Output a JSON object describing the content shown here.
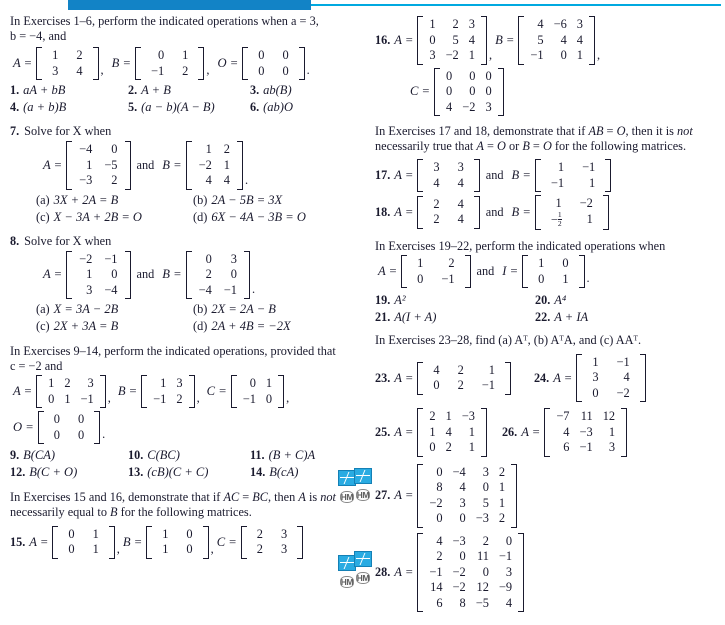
{
  "header": {
    "accent_color": "#1283c6",
    "rule_color": "#00a9e0"
  },
  "icons": {
    "graph_icon_name": "graphing-utility-icon",
    "hm_icon_label": "HM"
  },
  "left_column": {
    "intro_1_6": {
      "line1": "In Exercises 1–6, perform the indicated operations when a = 3,",
      "line2": "b = −4, and"
    },
    "defs_1_6": {
      "A_label": "A =",
      "A": [
        [
          "1",
          "2"
        ],
        [
          "3",
          "4"
        ]
      ],
      "A_punct": ",",
      "B_label": "B =",
      "B": [
        [
          "0",
          "1"
        ],
        [
          "−1",
          "2"
        ]
      ],
      "B_punct": ",",
      "O_label": "O =",
      "O": [
        [
          "0",
          "0"
        ],
        [
          "0",
          "0"
        ]
      ],
      "O_punct": "."
    },
    "ex_1_6": [
      {
        "num": "1.",
        "expr": "aA + bB"
      },
      {
        "num": "2.",
        "expr": "A + B"
      },
      {
        "num": "3.",
        "expr": "ab(B)"
      },
      {
        "num": "4.",
        "expr": "(a + b)B"
      },
      {
        "num": "5.",
        "expr": "(a − b)(A − B)"
      },
      {
        "num": "6.",
        "expr": "(ab)O"
      }
    ],
    "ex7": {
      "num": "7.",
      "prompt": "Solve for X when",
      "A_label": "A =",
      "A": [
        [
          "−4",
          "0"
        ],
        [
          "1",
          "−5"
        ],
        [
          "−3",
          "2"
        ]
      ],
      "and": "and",
      "B_label": "B =",
      "B": [
        [
          "1",
          "2"
        ],
        [
          "−2",
          "1"
        ],
        [
          "4",
          "4"
        ]
      ],
      "B_punct": ".",
      "options": [
        {
          "label": "(a)",
          "expr": "3X + 2A = B"
        },
        {
          "label": "(b)",
          "expr": "2A − 5B = 3X"
        },
        {
          "label": "(c)",
          "expr": "X − 3A + 2B = O"
        },
        {
          "label": "(d)",
          "expr": "6X − 4A − 3B = O"
        }
      ]
    },
    "ex8": {
      "num": "8.",
      "prompt": "Solve for X when",
      "A_label": "A =",
      "A": [
        [
          "−2",
          "−1"
        ],
        [
          "1",
          "0"
        ],
        [
          "3",
          "−4"
        ]
      ],
      "and": "and",
      "B_label": "B =",
      "B": [
        [
          "0",
          "3"
        ],
        [
          "2",
          "0"
        ],
        [
          "−4",
          "−1"
        ]
      ],
      "B_punct": ".",
      "options": [
        {
          "label": "(a)",
          "expr": "X = 3A − 2B"
        },
        {
          "label": "(b)",
          "expr": "2X = 2A − B"
        },
        {
          "label": "(c)",
          "expr": "2X + 3A = B"
        },
        {
          "label": "(d)",
          "expr": "2A + 4B = −2X"
        }
      ]
    },
    "intro_9_14": {
      "line1": "In Exercises 9–14, perform the indicated operations, provided that",
      "line2": "c = −2 and"
    },
    "defs_9_14": {
      "A_label": "A =",
      "A": [
        [
          "1",
          "2",
          "3"
        ],
        [
          "0",
          "1",
          "−1"
        ]
      ],
      "A_punct": ",",
      "B_label": "B =",
      "B": [
        [
          "1",
          "3"
        ],
        [
          "−1",
          "2"
        ]
      ],
      "B_punct": ",",
      "C_label": "C =",
      "C": [
        [
          "0",
          "1"
        ],
        [
          "−1",
          "0"
        ]
      ],
      "C_punct": ",",
      "O_label": "O =",
      "O": [
        [
          "0",
          "0"
        ],
        [
          "0",
          "0"
        ]
      ],
      "O_punct": "."
    },
    "ex_9_14": [
      {
        "num": "9.",
        "expr": "B(CA)"
      },
      {
        "num": "10.",
        "expr": "C(BC)"
      },
      {
        "num": "11.",
        "expr": "(B + C)A"
      },
      {
        "num": "12.",
        "expr": "B(C + O)"
      },
      {
        "num": "13.",
        "expr": "(cB)(C + C)"
      },
      {
        "num": "14.",
        "expr": "B(cA)"
      }
    ],
    "intro_15_16": {
      "line1": "In Exercises 15 and 16, demonstrate that if AC = BC, then A is not",
      "line2": "necessarily equal to B for the following matrices."
    },
    "ex15": {
      "num": "15.",
      "A_label": "A =",
      "A": [
        [
          "0",
          "1"
        ],
        [
          "0",
          "1"
        ]
      ],
      "A_punct": ",",
      "B_label": "B =",
      "B": [
        [
          "1",
          "0"
        ],
        [
          "1",
          "0"
        ]
      ],
      "B_punct": ",",
      "C_label": "C =",
      "C": [
        [
          "2",
          "3"
        ],
        [
          "2",
          "3"
        ]
      ]
    }
  },
  "right_column": {
    "ex16": {
      "num": "16.",
      "A_label": "A =",
      "A": [
        [
          "1",
          "2",
          "3"
        ],
        [
          "0",
          "5",
          "4"
        ],
        [
          "3",
          "−2",
          "1"
        ]
      ],
      "A_punct": ",",
      "B_label": "B =",
      "B": [
        [
          "4",
          "−6",
          "3"
        ],
        [
          "5",
          "4",
          "4"
        ],
        [
          "−1",
          "0",
          "1"
        ]
      ],
      "B_punct": ",",
      "C_label": "C =",
      "C": [
        [
          "0",
          "0",
          "0"
        ],
        [
          "0",
          "0",
          "0"
        ],
        [
          "4",
          "−2",
          "3"
        ]
      ]
    },
    "intro_17_18": {
      "line1": "In Exercises 17 and 18, demonstrate that if AB = O, then it is not",
      "line2": "necessarily true that A = O or B = O for the following matrices."
    },
    "ex17": {
      "num": "17.",
      "A_label": "A =",
      "A": [
        [
          "3",
          "3"
        ],
        [
          "4",
          "4"
        ]
      ],
      "and": "and",
      "B_label": "B =",
      "B": [
        [
          "1",
          "−1"
        ],
        [
          "−1",
          "1"
        ]
      ]
    },
    "ex18": {
      "num": "18.",
      "A_label": "A =",
      "A": [
        [
          "2",
          "4"
        ],
        [
          "2",
          "4"
        ]
      ],
      "and": "and",
      "B_label": "B =",
      "B": [
        [
          "1",
          "−2"
        ],
        [
          "−½",
          "1"
        ]
      ],
      "B_frac_row": 1,
      "B_frac_col": 0,
      "B_frac_num": "1",
      "B_frac_den": "2"
    },
    "intro_19_22": {
      "line1": "In Exercises 19–22, perform the indicated operations when",
      "A_label": "A =",
      "A": [
        [
          "1",
          "2"
        ],
        [
          "0",
          "−1"
        ]
      ],
      "and": "and",
      "I_label": "I =",
      "I": [
        [
          "1",
          "0"
        ],
        [
          "0",
          "1"
        ]
      ],
      "I_punct": "."
    },
    "ex_19_22": [
      {
        "num": "19.",
        "expr": "A²"
      },
      {
        "num": "20.",
        "expr": "A⁴"
      },
      {
        "num": "21.",
        "expr": "A(I + A)"
      },
      {
        "num": "22.",
        "expr": "A + IA"
      }
    ],
    "intro_23_28": "In Exercises 23–28, find (a) Aᵀ, (b) AᵀA, and (c) AAᵀ.",
    "ex23": {
      "num": "23.",
      "A_label": "A =",
      "A": [
        [
          "4",
          "2",
          "1"
        ],
        [
          "0",
          "2",
          "−1"
        ]
      ]
    },
    "ex24": {
      "num": "24.",
      "A_label": "A =",
      "A": [
        [
          "1",
          "−1"
        ],
        [
          "3",
          "4"
        ],
        [
          "0",
          "−2"
        ]
      ]
    },
    "ex25": {
      "num": "25.",
      "A_label": "A =",
      "A": [
        [
          "2",
          "1",
          "−3"
        ],
        [
          "1",
          "4",
          "1"
        ],
        [
          "0",
          "2",
          "1"
        ]
      ]
    },
    "ex26": {
      "num": "26.",
      "A_label": "A =",
      "A": [
        [
          "−7",
          "11",
          "12"
        ],
        [
          "4",
          "−3",
          "1"
        ],
        [
          "6",
          "−1",
          "3"
        ]
      ]
    },
    "ex27": {
      "num": "27.",
      "A_label": "A =",
      "A": [
        [
          "0",
          "−4",
          "3",
          "2"
        ],
        [
          "8",
          "4",
          "0",
          "1"
        ],
        [
          "−2",
          "3",
          "5",
          "1"
        ],
        [
          "0",
          "0",
          "−3",
          "2"
        ]
      ]
    },
    "ex28": {
      "num": "28.",
      "A_label": "A =",
      "A": [
        [
          "4",
          "−3",
          "2",
          "0"
        ],
        [
          "2",
          "0",
          "11",
          "−1"
        ],
        [
          "−1",
          "−2",
          "0",
          "3"
        ],
        [
          "14",
          "−2",
          "12",
          "−9"
        ],
        [
          "6",
          "8",
          "−5",
          "4"
        ]
      ]
    }
  }
}
